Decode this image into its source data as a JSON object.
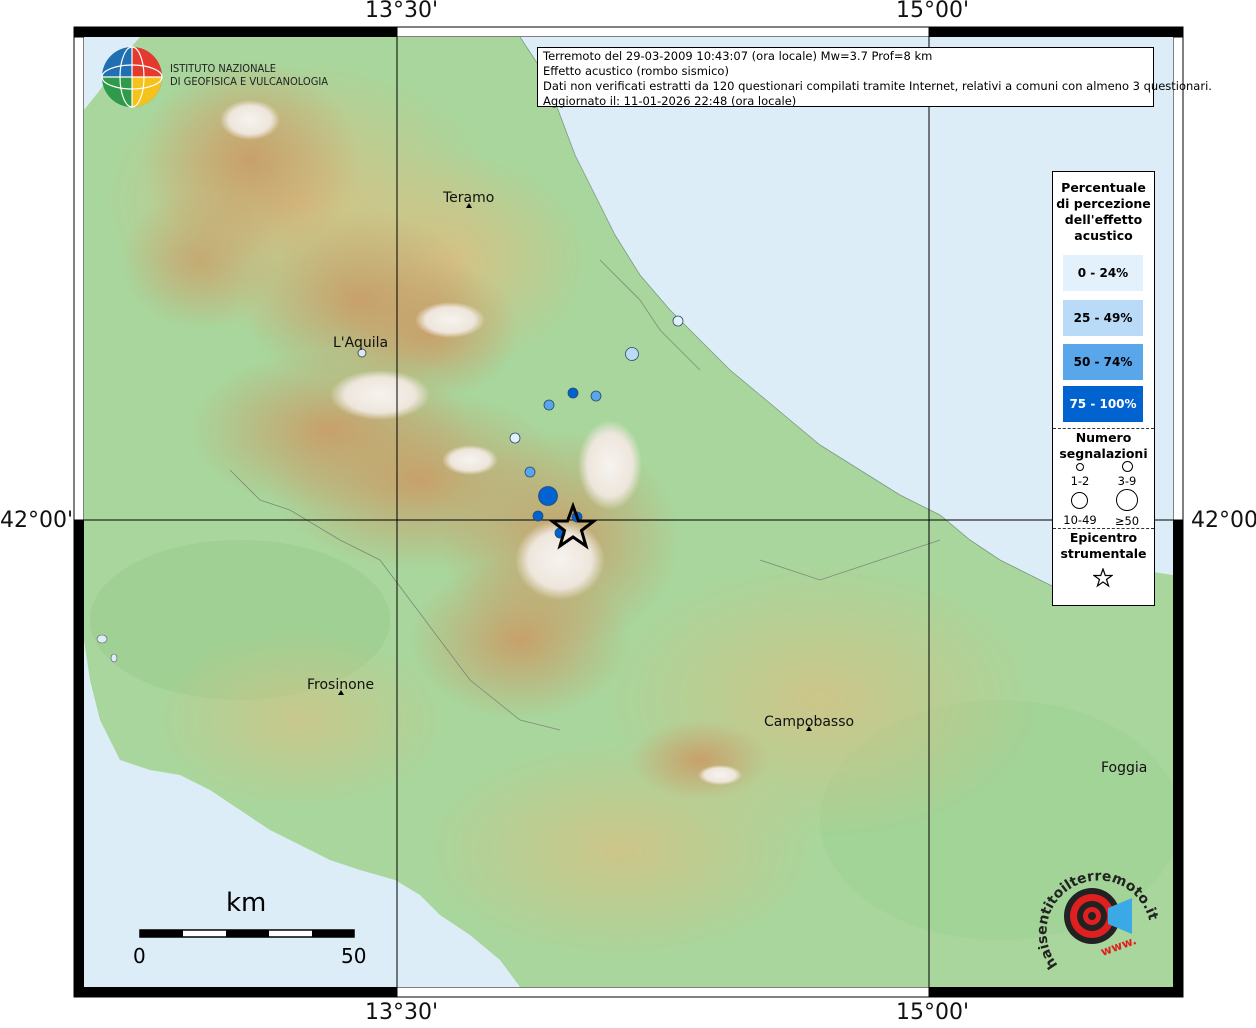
{
  "coords": {
    "lon_1": "13°30'",
    "lon_2": "15°00'",
    "lat_1": "42°00'"
  },
  "logo": {
    "line1": "ISTITUTO NAZIONALE",
    "line2": "DI GEOFISICA E VULCANOLOGIA"
  },
  "info": {
    "line1": "Terremoto del 29-03-2009 10:43:07 (ora locale) Mw=3.7 Prof=8 km",
    "line2": "Effetto acustico (rombo sismico)",
    "line3": "Dati non verificati estratti da 120 questionari compilati tramite Internet, relativi a comuni con almeno 3 questionari.",
    "line4": "Aggiornato il: 11-01-2026 22:48 (ora locale)"
  },
  "legend": {
    "title1": "Percentuale",
    "title2": "di percezione",
    "title3": "dell'effetto",
    "title4": "acustico",
    "classes": [
      {
        "label": "0 - 24%",
        "color": "#e3f1fd"
      },
      {
        "label": "25 - 49%",
        "color": "#b9dbf7"
      },
      {
        "label": "50 - 74%",
        "color": "#5aa6ea"
      },
      {
        "label": "75 - 100%",
        "color": "#0063cf"
      }
    ],
    "count_title1": "Numero",
    "count_title2": "segnalazioni",
    "counts": [
      "1-2",
      "3-9",
      "10-49",
      "≥50"
    ],
    "epi_title1": "Epicentro",
    "epi_title2": "strumentale"
  },
  "cities": {
    "teramo": "Teramo",
    "laquila": "L'Aquila",
    "frosinone": "Frosinone",
    "campobasso": "Campobasso",
    "foggia": "Foggia"
  },
  "scale": {
    "unit": "km",
    "min": "0",
    "max": "50"
  },
  "watermark": {
    "text": "haisentitoilterremoto.it",
    "www": "www."
  },
  "colors": {
    "sea": "#dcedf8",
    "lowland": "#a9d8a0",
    "hill": "#d8c48a",
    "mountain": "#c29a5e",
    "peak": "#f3f1ee",
    "pct_0_24": "#e3f1fd",
    "pct_25_49": "#b9dbf7",
    "pct_50_74": "#5aa6ea",
    "pct_75_100": "#0063cf"
  }
}
